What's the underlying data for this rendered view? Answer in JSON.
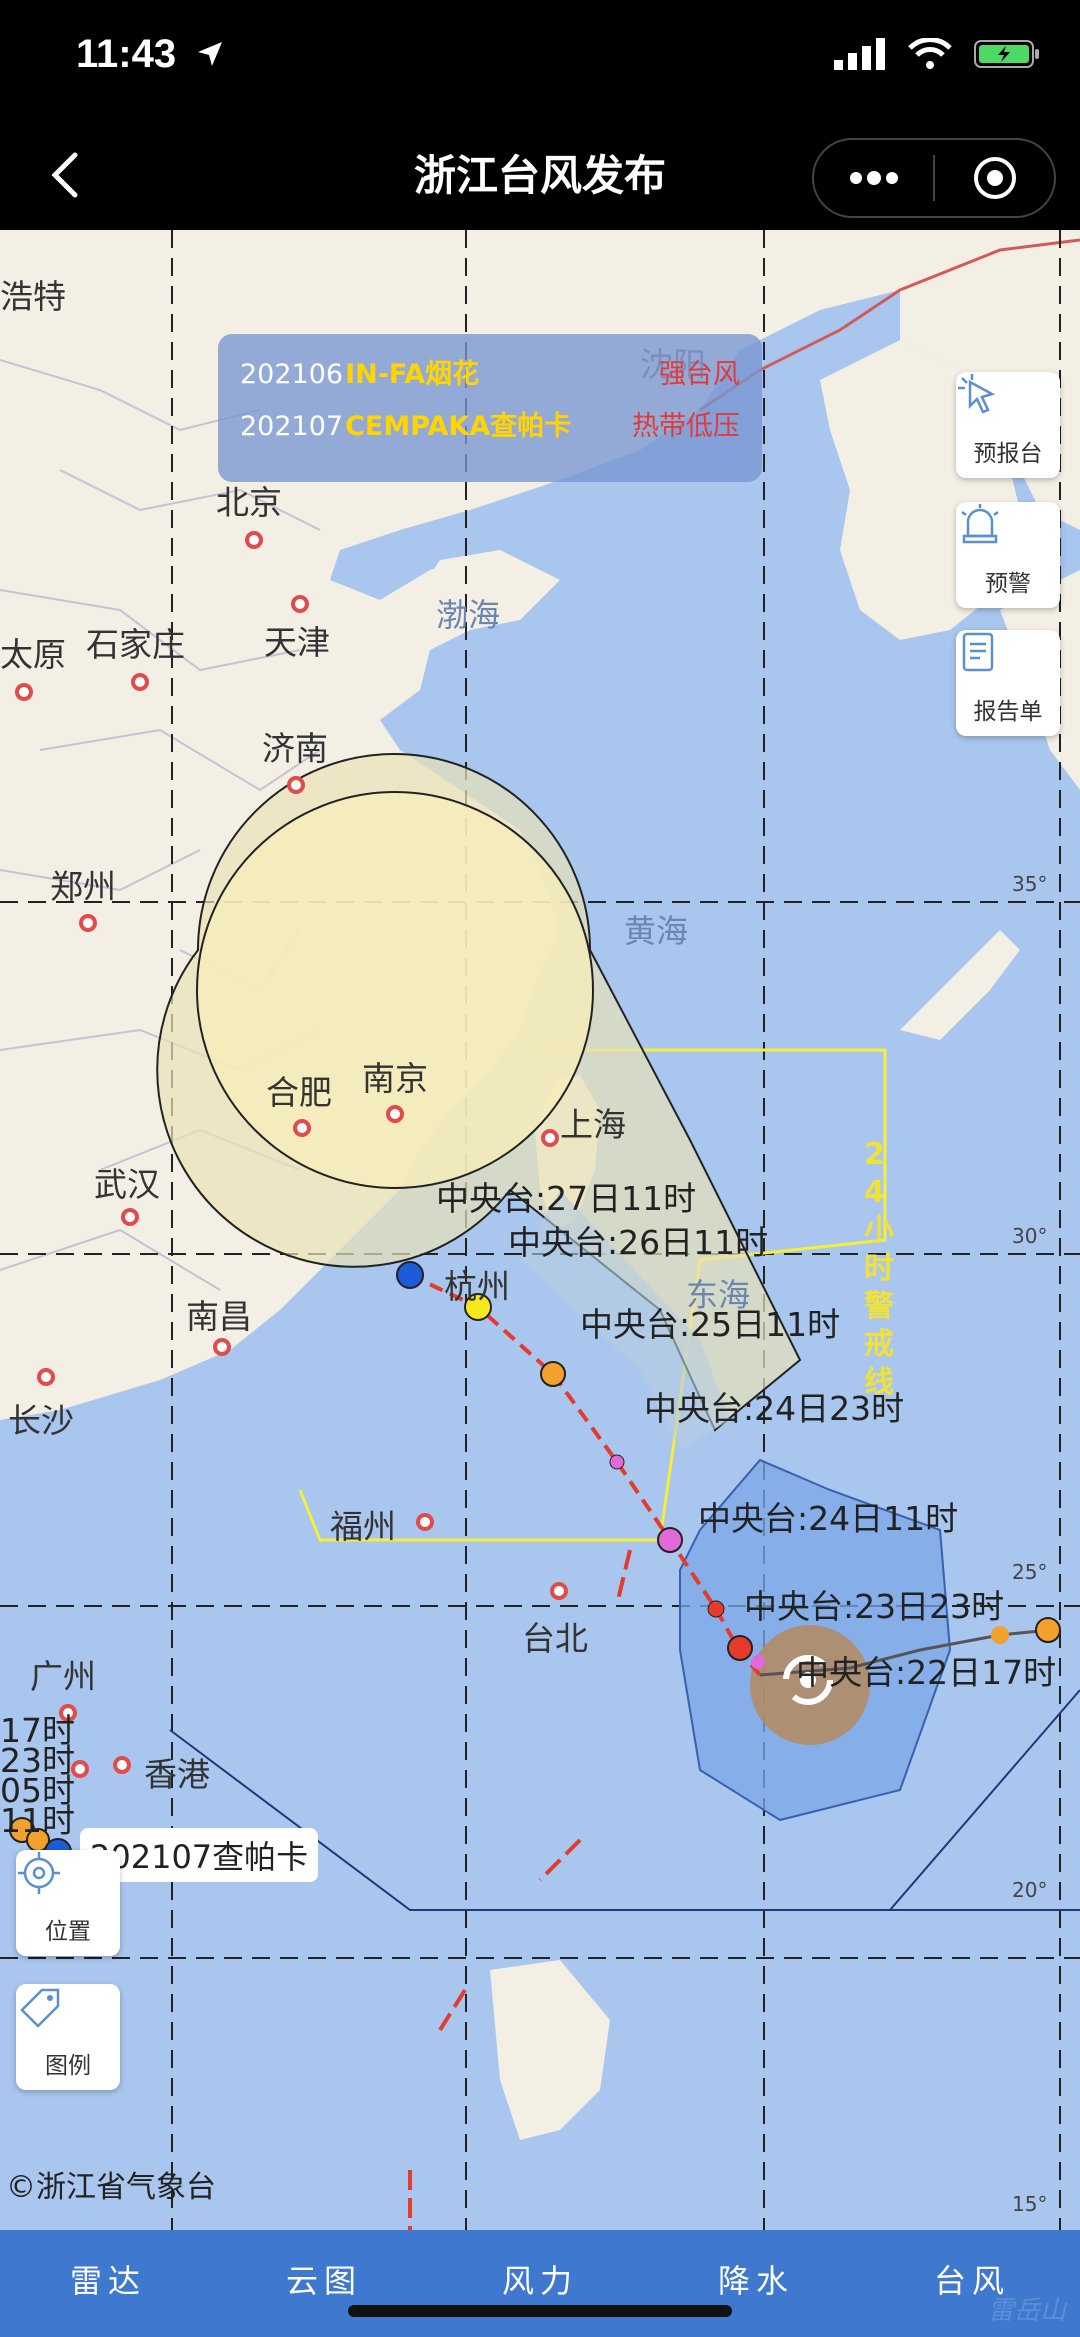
{
  "status": {
    "time": "11:43"
  },
  "nav": {
    "title": "浙江台风发布"
  },
  "legend_box": {
    "rows": [
      {
        "id": "202106",
        "name": "IN-FA烟花",
        "level": "强台风"
      },
      {
        "id": "202107",
        "name": "CEMPAKA查帕卡",
        "level": "热带低压"
      }
    ]
  },
  "side_buttons": {
    "report_station": "预报台",
    "warning": "预警",
    "report_sheet": "报告单"
  },
  "left_buttons": {
    "location": "位置",
    "legend": "图例"
  },
  "cities": {
    "beijing": "北京",
    "tianjin": "天津",
    "shijiazhuang": "石家庄",
    "taiyuan": "太原",
    "hohhot": "浩特",
    "jinan": "济南",
    "zhengzhou": "郑州",
    "hefei": "合肥",
    "nanjing": "南京",
    "shanghai": "上海",
    "wuhan": "武汉",
    "hangzhou": "杭州",
    "nanchang": "南昌",
    "changsha": "长沙",
    "fuzhou": "福州",
    "taipei": "台北",
    "guangzhou": "广州",
    "hongkong": "香港",
    "shenyang": "沈阳"
  },
  "seas": {
    "bohai": "渤海",
    "yellow": "黄海",
    "east": "东海"
  },
  "latitudes": {
    "l35": "35°",
    "l30": "30°",
    "l25": "25°",
    "l20": "20°",
    "l15": "15°"
  },
  "warning_line_label": "24小时警戒线",
  "forecast_points": [
    {
      "label": "中央台:27日11时"
    },
    {
      "label": "中央台:26日11时"
    },
    {
      "label": "中央台:25日11时"
    },
    {
      "label": "中央台:24日23时"
    },
    {
      "label": "中央台:24日11时"
    },
    {
      "label": "中央台:23日23时"
    },
    {
      "label": "中央台:22日17时"
    }
  ],
  "cempaka": {
    "tag": "202107查帕卡",
    "labels": [
      "17时",
      "23时",
      "05时",
      "11时"
    ]
  },
  "credit": "©浙江省气象台",
  "tabs": [
    "雷达",
    "云图",
    "风力",
    "降水",
    "台风"
  ],
  "watermark": "雷岳山",
  "colors": {
    "tab_bg": "#3f78cf",
    "sea": "#a9c6ee",
    "land": "#f3efe4",
    "track": "#e53b2c",
    "warning_line": "#f5ee3a"
  }
}
